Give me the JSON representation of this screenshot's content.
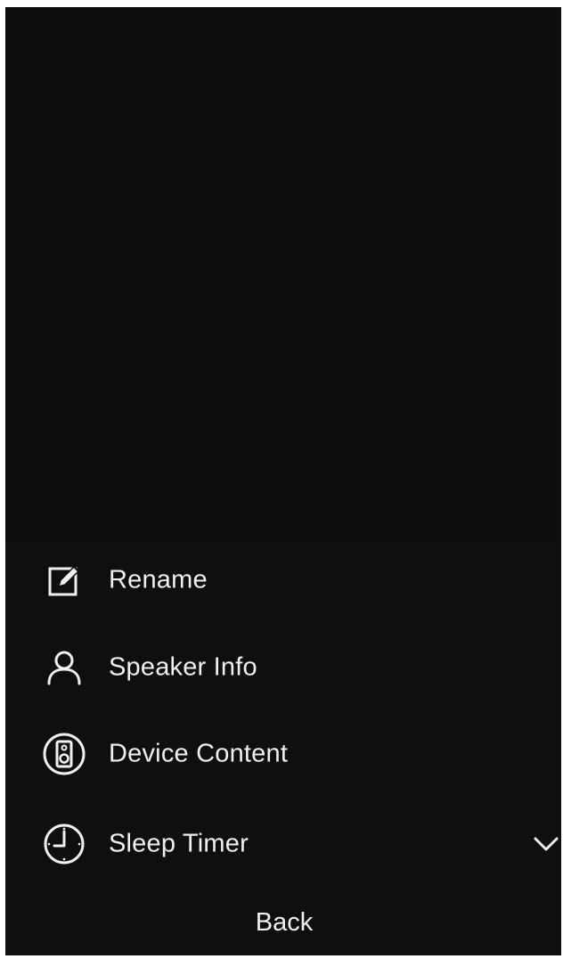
{
  "menu": {
    "items": [
      {
        "label": "Rename",
        "icon": "rename-icon"
      },
      {
        "label": "Speaker Info",
        "icon": "person-icon"
      },
      {
        "label": "Device Content",
        "icon": "speaker-device-icon"
      },
      {
        "label": "Sleep Timer",
        "icon": "clock-icon",
        "trailing_icon": "chevron-down-icon"
      }
    ]
  },
  "footer": {
    "back_label": "Back"
  },
  "colors": {
    "background": "#0f0f0f",
    "text": "#f0f0f0",
    "page_border": "#ffffff"
  }
}
